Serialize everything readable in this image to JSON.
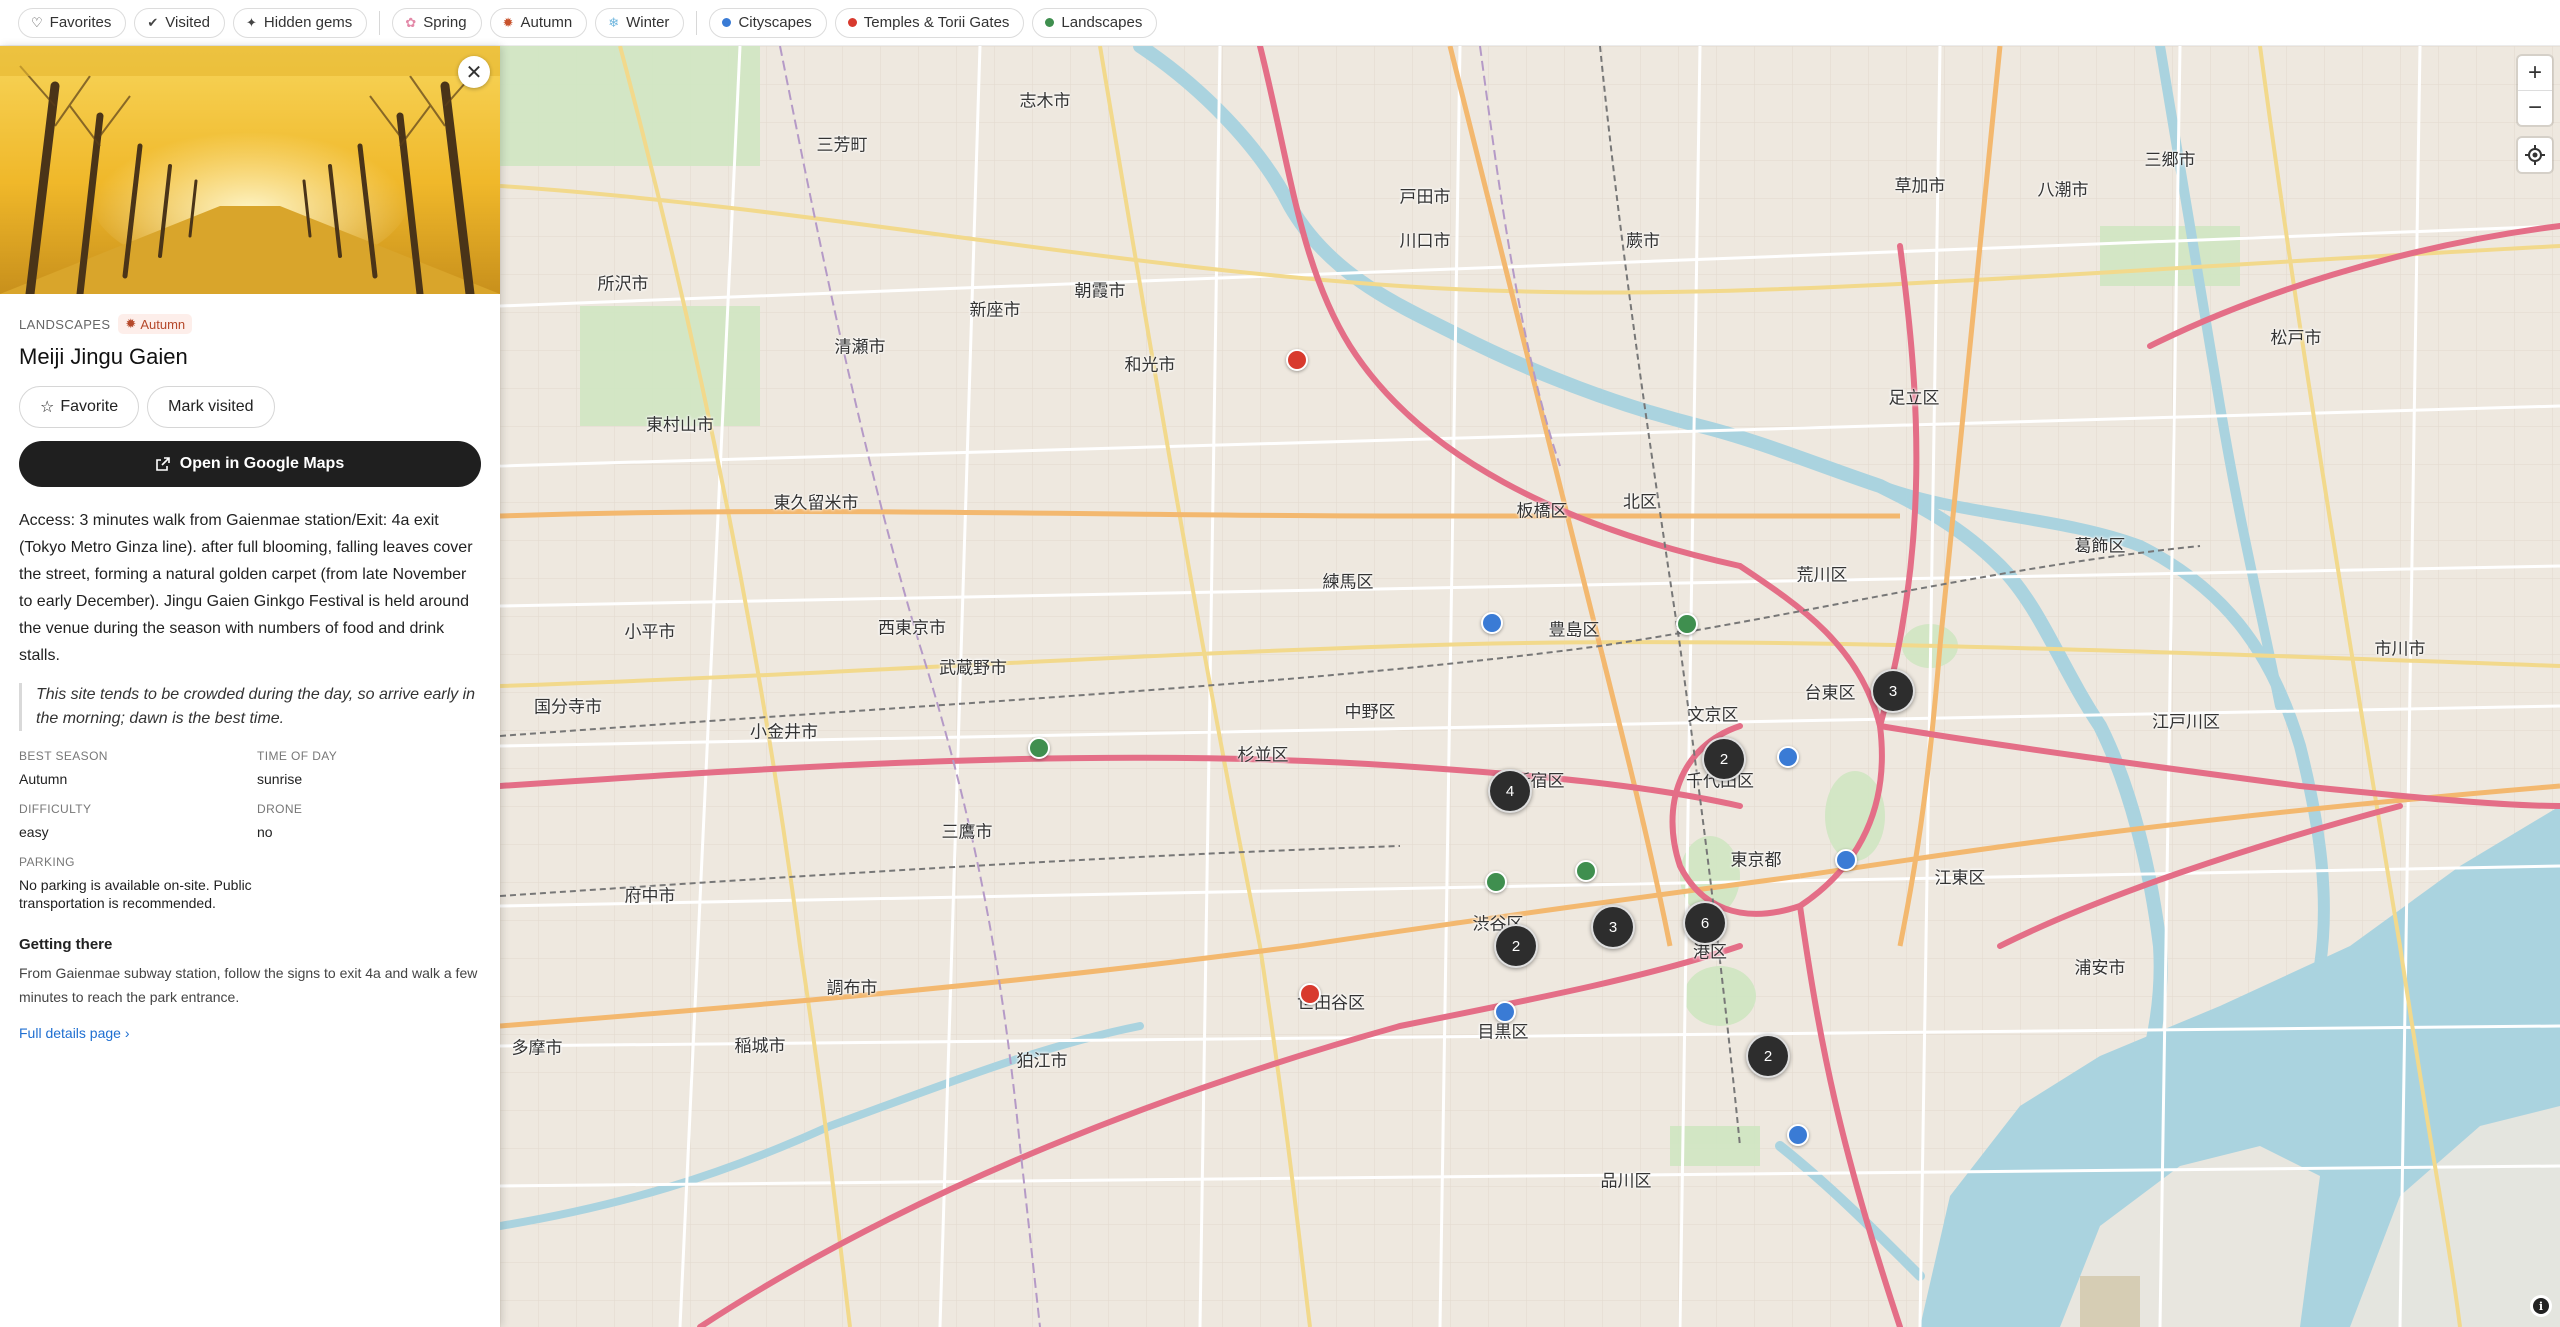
{
  "filters": [
    {
      "icon": "heart-icon",
      "glyph": "♡",
      "label": "Favorites"
    },
    {
      "icon": "check-circle-icon",
      "glyph": "✔",
      "label": "Visited"
    },
    {
      "icon": "sparkle-icon",
      "glyph": "✦",
      "label": "Hidden gems"
    },
    {
      "icon": "blossom-icon",
      "glyph": "✿",
      "glyph_color": "#e389a8",
      "label": "Spring"
    },
    {
      "icon": "maple-leaf-icon",
      "glyph": "🍁",
      "glyph_color": "#c8522c",
      "label": "Autumn"
    },
    {
      "icon": "snowflake-icon",
      "glyph": "❄",
      "glyph_color": "#6fb6de",
      "label": "Winter"
    }
  ],
  "categories": [
    {
      "label": "Cityscapes",
      "color": "#3a7bd5"
    },
    {
      "label": "Temples & Torii Gates",
      "color": "#d83a2e"
    },
    {
      "label": "Landscapes",
      "color": "#3f8f4f"
    }
  ],
  "spot": {
    "category": "LANDSCAPES",
    "season": "Autumn",
    "title": "Meiji Jingu Gaien",
    "favorite_label": "Favorite",
    "visited_label": "Mark visited",
    "gmaps_label": "Open in Google Maps",
    "description": "Access: 3 minutes walk from Gaienmae station/Exit: 4a exit (Tokyo Metro Ginza line). after full blooming, falling leaves cover the street, forming a natural golden carpet (from late November to early December). Jingu Gaien Ginkgo Festival is held around the venue during the season with numbers of food and drink stalls.",
    "tip": "This site tends to be crowded during the day, so arrive early in the morning; dawn is the best time.",
    "facts": {
      "best_season_label": "BEST SEASON",
      "best_season": "Autumn",
      "time_label": "TIME OF DAY",
      "time": "sunrise",
      "difficulty_label": "DIFFICULTY",
      "difficulty": "easy",
      "drone_label": "DRONE",
      "drone": "no",
      "parking_label": "PARKING",
      "parking": "No parking is available on-site. Public transportation is recommended."
    },
    "getting_there_title": "Getting there",
    "getting_there": "From Gaienmae subway station, follow the signs to exit 4a and walk a few minutes to reach the park entrance.",
    "details_link": "Full details page ›"
  },
  "map": {
    "labels": [
      "志木市",
      "三芳町",
      "所沢市",
      "新座市",
      "朝霞市",
      "清瀬市",
      "和光市",
      "東村山市",
      "東久留米市",
      "板橋区",
      "北区",
      "足立区",
      "練馬区",
      "豊島区",
      "荒川区",
      "葛飾区",
      "西東京市",
      "小平市",
      "武蔵野市",
      "中野区",
      "台東区",
      "文京区",
      "国分寺市",
      "小金井市",
      "杉並区",
      "新宿区",
      "千代田区",
      "江戸川区",
      "三鷹市",
      "東京都",
      "江東区",
      "府中市",
      "渋谷区",
      "港区",
      "世田谷区",
      "調布市",
      "目黒区",
      "狛江市",
      "稲城市",
      "多摩市",
      "浦安市",
      "品川区",
      "川口市",
      "戸田市",
      "蕨市",
      "草加市",
      "八潮市",
      "三郷市",
      "松戸市",
      "市川市"
    ],
    "clusters": [
      "3",
      "2",
      "4",
      "3",
      "6",
      "2",
      "2"
    ],
    "zoom_in": "+",
    "zoom_out": "−",
    "attribution": "i"
  },
  "colors": {
    "cityscape": "#3a7bd5",
    "temple": "#d83a2e",
    "landscape": "#3f8f4f",
    "autumn": "#b5482a"
  }
}
